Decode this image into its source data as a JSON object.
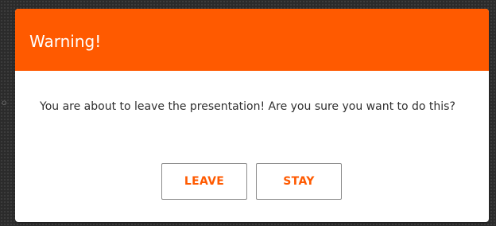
{
  "dialog": {
    "title": "Warning!",
    "message": "You are about to leave the presentation! Are you sure you want to do this?",
    "buttons": {
      "leave_label": "LEAVE",
      "stay_label": "STAY"
    }
  },
  "colors": {
    "accent": "#ff5a00",
    "header_text": "#ffffff",
    "body_text": "#2f2f2f",
    "button_border": "#8c8c8c",
    "backdrop": "#2b2b2b"
  }
}
